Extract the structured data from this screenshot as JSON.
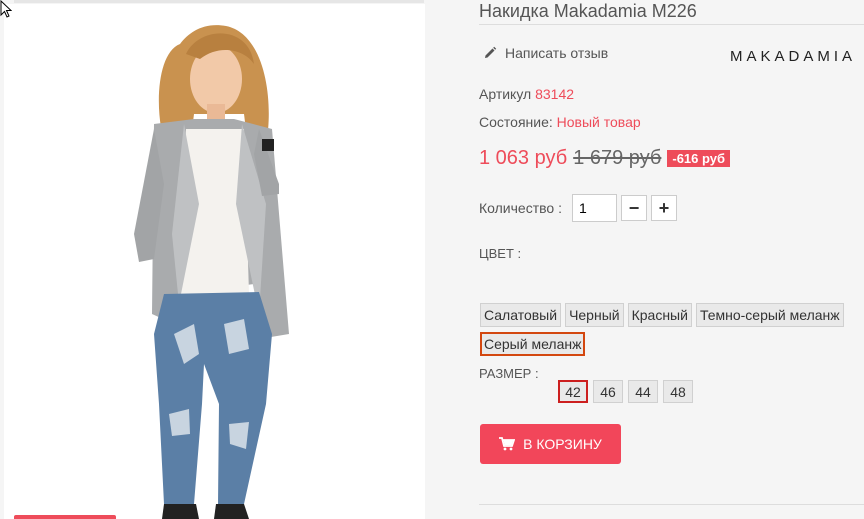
{
  "product": {
    "title": "Накидка Makadamia M226",
    "review_label": "Написать отзыв",
    "brand": "MAKADAMIA",
    "sku_label": "Артикул",
    "sku_value": "83142",
    "condition_label": "Состояние:",
    "condition_value": "Новый товар",
    "price_new": "1 063 руб",
    "price_old": "1 679 руб",
    "discount": "-616 руб",
    "quantity_label": "Количество :",
    "quantity_value": "1",
    "minus": "−",
    "plus": "+",
    "color_label": "ЦВЕТ :",
    "colors": [
      "Салатовый",
      "Черный",
      "Красный",
      "Темно-серый меланж",
      "Серый меланж"
    ],
    "selected_color": "Серый меланж",
    "size_label": "РАЗМЕР :",
    "sizes": [
      "42",
      "46",
      "44",
      "48"
    ],
    "selected_size": "42",
    "cart_label": "В КОРЗИНУ"
  },
  "icons": {
    "review": "pencil-icon",
    "cart": "cart-icon",
    "cursor": "mouse-cursor-icon"
  },
  "colors": {
    "accent": "#ee4c5a",
    "button": "#f2465a",
    "selected_color_border": "#d3470f",
    "selected_size_border": "#cc1f1f"
  }
}
